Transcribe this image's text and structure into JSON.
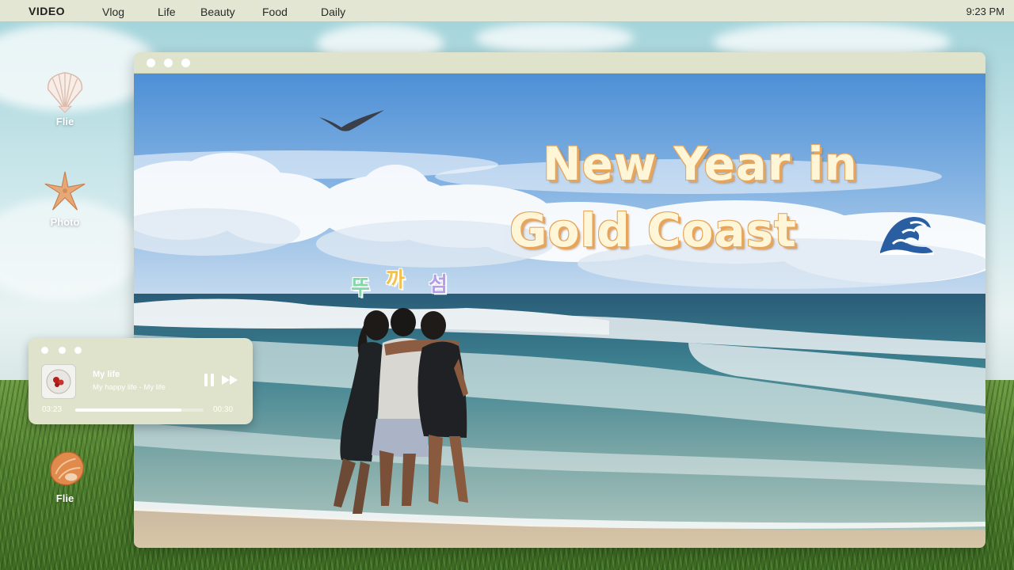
{
  "menubar": {
    "brand": "VIDEO",
    "items": [
      "Vlog",
      "Life",
      "Beauty",
      "Food",
      "Daily"
    ],
    "clock": "9:23 PM"
  },
  "desktop_icons": [
    {
      "label": "Flie",
      "icon": "scallop-shell-icon"
    },
    {
      "label": "Photo",
      "icon": "starfish-icon"
    },
    {
      "label": "Flie",
      "icon": "conch-shell-icon"
    }
  ],
  "video": {
    "title_line1": "New Year in",
    "title_line2": "Gold Coast",
    "title_emoji": "wave-icon",
    "korean_chars": [
      "뚜",
      "까",
      "섬"
    ],
    "korean_colors": [
      "#7fd9a6",
      "#f2c14e",
      "#b59ee8"
    ]
  },
  "player": {
    "song_title": "My life",
    "artist": "My happy life - My life",
    "elapsed": "03:23",
    "duration": "00:30",
    "progress": 0.83
  },
  "colors": {
    "window_chrome": "#dfe3cb",
    "title_fill": "#fff6d8",
    "title_outline": "#e6a55a"
  }
}
